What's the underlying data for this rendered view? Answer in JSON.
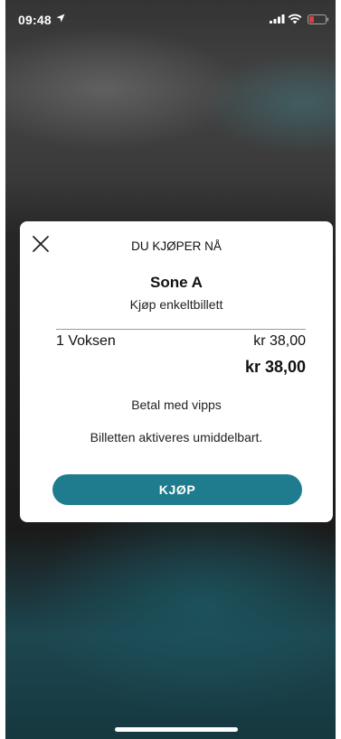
{
  "status_bar": {
    "time": "09:48",
    "icons": [
      "location-arrow-icon",
      "signal-icon",
      "wifi-icon",
      "battery-icon"
    ]
  },
  "modal": {
    "close_icon": "close-icon",
    "heading": "DU KJØPER NÅ",
    "zone": "Sone A",
    "ticket_type": "Kjøp enkeltbillett",
    "line_item": {
      "label": "1 Voksen",
      "price": "kr 38,00"
    },
    "total": "kr 38,00",
    "payment_method": "Betal med vipps",
    "activation_note": "Billetten aktiveres umiddelbart.",
    "buy_label": "KJØP"
  },
  "colors": {
    "accent": "#1f7c8e",
    "modal_background": "#ffffff",
    "backdrop": "#1b1b1b"
  }
}
